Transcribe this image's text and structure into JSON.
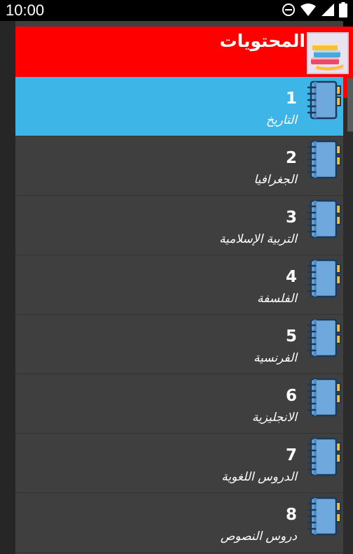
{
  "status_bar": {
    "time": "10:00",
    "icons": [
      "do-not-disturb-icon",
      "wifi-icon",
      "signal-icon",
      "battery-icon"
    ]
  },
  "header": {
    "title": "المحتويات",
    "logo_icon": "books-logo-icon",
    "color": "#ff0000"
  },
  "list": {
    "selected_color": "#3db5e6",
    "items": [
      {
        "number": "1",
        "label": "التاريخ",
        "icon": "notebook-icon"
      },
      {
        "number": "2",
        "label": "الجغرافيا",
        "icon": "notebook-icon"
      },
      {
        "number": "3",
        "label": "التربية الإسلامية",
        "icon": "notebook-icon"
      },
      {
        "number": "4",
        "label": "الفلسفة",
        "icon": "notebook-icon"
      },
      {
        "number": "5",
        "label": "الفرنسية",
        "icon": "notebook-icon"
      },
      {
        "number": "6",
        "label": "الانجليزية",
        "icon": "notebook-icon"
      },
      {
        "number": "7",
        "label": "الدروس اللغوية",
        "icon": "notebook-icon"
      },
      {
        "number": "8",
        "label": "دروس النصوص",
        "icon": "notebook-icon"
      }
    ]
  }
}
